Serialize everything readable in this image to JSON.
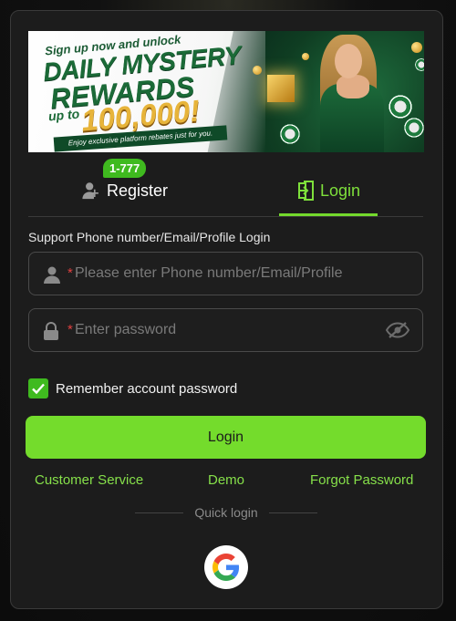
{
  "banner": {
    "line1": "Sign up now and unlock",
    "line2": "DAILY MYSTERY",
    "line3": "REWARDS",
    "line4": "up to",
    "amount": "100,000!",
    "ribbon": "Enjoy exclusive platform rebates just for you."
  },
  "tabs": {
    "register_label": "Register",
    "register_badge": "1-777",
    "login_label": "Login",
    "active": "login"
  },
  "form": {
    "support_label": "Support Phone number/Email/Profile Login",
    "account_required": "*",
    "account_placeholder": "Please enter Phone number/Email/Profile",
    "password_required": "*",
    "password_placeholder": "Enter password",
    "remember_label": "Remember account password",
    "remember_checked": true,
    "login_button": "Login"
  },
  "links": {
    "customer_service": "Customer Service",
    "demo": "Demo",
    "forgot_password": "Forgot Password"
  },
  "quick_login": {
    "label": "Quick login",
    "providers": [
      "google-icon"
    ]
  },
  "colors": {
    "accent": "#74dc2c",
    "badge": "#3fba1f",
    "link": "#86e04a",
    "required": "#e04040"
  }
}
